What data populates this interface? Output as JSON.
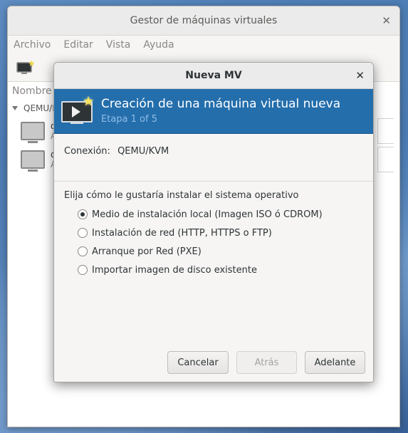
{
  "main_window": {
    "title": "Gestor de máquinas virtuales",
    "menu": [
      "Archivo",
      "Editar",
      "Vista",
      "Ayuda"
    ],
    "list_header": "Nombre",
    "group": "QEMU/K",
    "vms": [
      {
        "name": "d",
        "status": "A"
      },
      {
        "name": "d",
        "status": "A"
      }
    ]
  },
  "dialog": {
    "title": "Nueva MV",
    "banner": {
      "title": "Creación de una máquina virtual nueva",
      "step": "Etapa 1 of 5"
    },
    "connection": {
      "label": "Conexión:",
      "value": "QEMU/KVM"
    },
    "prompt": "Elija cómo le gustaría instalar el sistema operativo",
    "options": [
      {
        "label": "Medio de instalación local (Imagen ISO ó CDROM)",
        "selected": true
      },
      {
        "label": "Instalación de red (HTTP, HTTPS o FTP)",
        "selected": false
      },
      {
        "label": "Arranque por Red (PXE)",
        "selected": false
      },
      {
        "label": "Importar imagen de disco existente",
        "selected": false
      }
    ],
    "buttons": {
      "cancel": "Cancelar",
      "back": "Atrás",
      "forward": "Adelante"
    }
  },
  "icons": {
    "close": "close-icon",
    "new_vm": "new-vm-icon",
    "monitor": "vm-monitor-icon",
    "banner": "new-vm-banner-icon",
    "expand": "chevron-down-icon"
  },
  "colors": {
    "banner_bg": "#246eac",
    "banner_step": "#8fbde6",
    "desktop": "#4e7fb6"
  }
}
